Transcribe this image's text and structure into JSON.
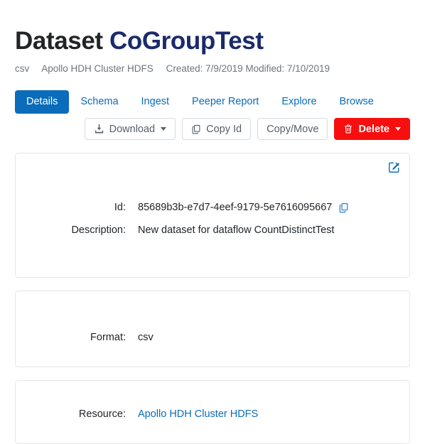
{
  "header": {
    "title_prefix": "Dataset",
    "dataset_name": "CoGroupTest",
    "subtitle": {
      "format": "csv",
      "resource": "Apollo HDH Cluster HDFS",
      "dates": "Created: 7/9/2019 Modified: 7/10/2019"
    }
  },
  "tabs": [
    {
      "label": "Details",
      "active": true
    },
    {
      "label": "Schema",
      "active": false
    },
    {
      "label": "Ingest",
      "active": false
    },
    {
      "label": "Peeper Report",
      "active": false
    },
    {
      "label": "Explore",
      "active": false
    },
    {
      "label": "Browse",
      "active": false
    }
  ],
  "toolbar": {
    "download_label": "Download",
    "copy_id_label": "Copy Id",
    "copy_move_label": "Copy/Move",
    "delete_label": "Delete"
  },
  "cards": {
    "identity": {
      "id_label": "Id:",
      "id_value": "85689b3b-e7d7-4eef-9179-5e7616095667",
      "description_label": "Description:",
      "description_value": "New dataset for dataflow CountDistinctTest"
    },
    "format": {
      "label": "Format:",
      "value": "csv"
    },
    "resource": {
      "label": "Resource:",
      "value": "Apollo HDH Cluster HDFS"
    }
  },
  "colors": {
    "accent_blue": "#0a6cba",
    "title_navy": "#1a2a6c",
    "danger_red": "#f70f0f",
    "muted_gray": "#6c757d",
    "card_border": "#e3e6e8"
  },
  "icons": {
    "edit": "edit-square-icon",
    "copy": "copy-icon",
    "download": "download-icon",
    "trash": "trash-icon"
  }
}
